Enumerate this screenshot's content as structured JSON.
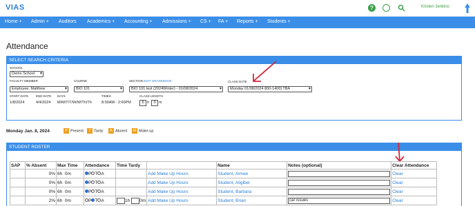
{
  "header": {
    "logo": "VIAS",
    "user_name": "Kristen Jenkins",
    "icons": {
      "help": "help-icon",
      "globe": "globe-icon",
      "search": "search-icon"
    }
  },
  "nav": {
    "items": [
      "Home +",
      "Admin +",
      "Auditors",
      "Academics +",
      "Accounting +",
      "Admissions +",
      "CS +",
      "FA +",
      "Reports +",
      "Students +"
    ]
  },
  "page": {
    "title": "Attendance"
  },
  "search": {
    "header": "SELECT SEARCH CRITERIA",
    "school_label": "SCHOOL",
    "school_value": "Demo School",
    "faculty_label": "FACULTY MEMBER",
    "faculty_value": "Employee, Matthew",
    "course_label": "COURSE",
    "course_value": "BIO 101",
    "section_label": "SECTION",
    "section_edit": "EDIT GRADEBOOK",
    "section_value": "BIO 101 test (2024Winter) - 01/08/2024",
    "class_date_label": "CLASS DATE",
    "class_date_value": "Monday 01/08/2024 800-1400] TBA",
    "start_date_label": "START DATE",
    "start_date_value": "1/8/2024",
    "end_date_label": "END DATE",
    "end_date_value": "4/4/2024",
    "days_label": "DAYS",
    "days_value": "M/M/T/T/W/W/Th/Th",
    "times_label": "TIMES",
    "times_value": "8:00AM - 2:00PM",
    "class_length_label": "CLASS LENGTH",
    "class_length_h": "6",
    "class_length_h_unit": "h",
    "class_length_m": "0",
    "class_length_m_unit": "m"
  },
  "date_line": "Monday Jan. 8, 2024",
  "legend": [
    {
      "code": "P",
      "label": "Present",
      "color": "#f0a020"
    },
    {
      "code": "T",
      "label": "Tardy",
      "color": "#f0a020"
    },
    {
      "code": "A",
      "label": "Absent",
      "color": "#f0a020"
    },
    {
      "code": "M",
      "label": "Make-up",
      "color": "#f0a020"
    }
  ],
  "roster": {
    "header": "STUDENT ROSTER",
    "columns": [
      "SAP",
      "% Absent",
      "Max Time",
      "Attendance",
      "Time Tardy",
      "",
      "Name",
      "Notes (optional)",
      "Clear Attendance"
    ],
    "attendance_letters": [
      "P",
      "T",
      "A"
    ],
    "rows": [
      {
        "absent": "0%",
        "max_h": "6h",
        "max_m": "0m",
        "selected": 0,
        "tardy": false,
        "makeup": "Add Make Up Hours",
        "name": "Student, Aimee",
        "notes": "",
        "clear": "Clear"
      },
      {
        "absent": "0%",
        "max_h": "6h",
        "max_m": "0m",
        "selected": 0,
        "tardy": false,
        "makeup": "Add Make Up Hours",
        "name": "Student, Aligibel",
        "notes": "",
        "clear": "Clear"
      },
      {
        "absent": "0%",
        "max_h": "6h",
        "max_m": "0m",
        "selected": 0,
        "tardy": false,
        "makeup": "Add Make Up Hours",
        "name": "Student, Barbara",
        "notes": "",
        "clear": "Clear"
      },
      {
        "absent": "2%",
        "max_h": "6h",
        "max_m": "0m",
        "selected": 1,
        "tardy": true,
        "tardy_h": "1",
        "tardy_m": "0",
        "makeup": "Add Make Up Hours",
        "name": "Student, Brian",
        "notes": "car issues",
        "clear": "Clear"
      }
    ],
    "time_units": {
      "h": "h",
      "m": "m"
    }
  },
  "colors": {
    "accent": "#3b8ee8",
    "link": "#2a7fd4",
    "annotation": "#d0283a"
  }
}
